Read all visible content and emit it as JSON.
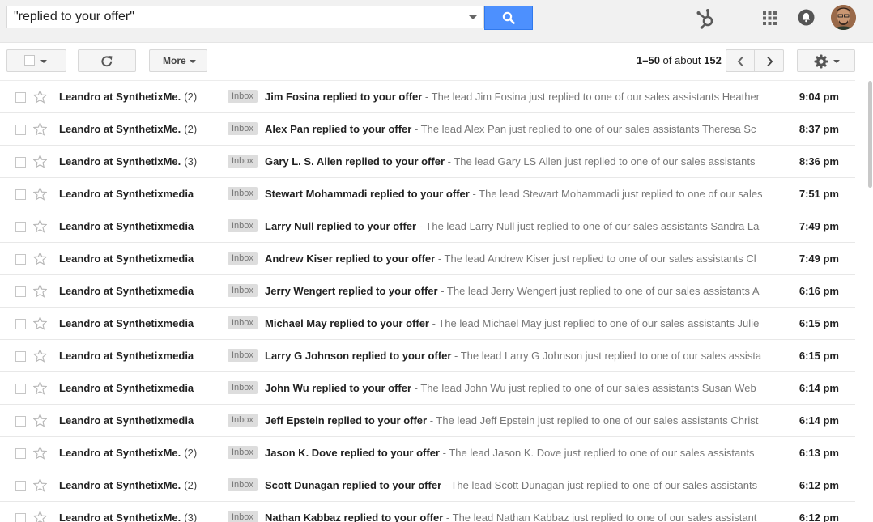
{
  "search": {
    "query": "\"replied to your offer\""
  },
  "toolbar": {
    "more_label": "More",
    "paging_range": "1–50",
    "paging_of": "of about",
    "paging_total": "152"
  },
  "icons": {
    "search": "search-icon",
    "hubspot": "hubspot-sprocket-icon",
    "apps": "apps-grid-icon",
    "notifications": "bell-icon",
    "refresh": "refresh-icon",
    "prev": "chevron-left-icon",
    "next": "chevron-right-icon",
    "settings": "gear-icon",
    "star": "star-icon"
  },
  "colors": {
    "search_button": "#4d90fe",
    "header_bg": "#f1f1f1",
    "inbox_badge_bg": "#dddddd"
  },
  "messages": [
    {
      "sender": "Leandro at ",
      "sender_org": "SynthetixMe.",
      "count": "(2)",
      "label": "Inbox",
      "subject": "Jim Fosina replied to your offer",
      "snippet": " - The lead Jim Fosina just replied to one of our sales assistants Heather",
      "time": "9:04 pm"
    },
    {
      "sender": "Leandro at ",
      "sender_org": "SynthetixMe.",
      "count": "(2)",
      "label": "Inbox",
      "subject": "Alex Pan replied to your offer",
      "snippet": " - The lead Alex Pan just replied to one of our sales assistants Theresa Sc",
      "time": "8:37 pm"
    },
    {
      "sender": "Leandro at ",
      "sender_org": "SynthetixMe.",
      "count": "(3)",
      "label": "Inbox",
      "subject": "Gary L. S. Allen replied to your offer",
      "snippet": " - The lead Gary LS Allen just replied to one of our sales assistants",
      "time": "8:36 pm"
    },
    {
      "sender": "Leandro at ",
      "sender_org": "Synthetixmedia",
      "count": "",
      "label": "Inbox",
      "subject": "Stewart Mohammadi replied to your offer",
      "snippet": " - The lead Stewart Mohammadi just replied to one of our sales",
      "time": "7:51 pm"
    },
    {
      "sender": "Leandro at ",
      "sender_org": "Synthetixmedia",
      "count": "",
      "label": "Inbox",
      "subject": "Larry Null replied to your offer",
      "snippet": " - The lead Larry Null just replied to one of our sales assistants Sandra La",
      "time": "7:49 pm"
    },
    {
      "sender": "Leandro at ",
      "sender_org": "Synthetixmedia",
      "count": "",
      "label": "Inbox",
      "subject": "Andrew Kiser replied to your offer",
      "snippet": " - The lead Andrew Kiser just replied to one of our sales assistants Cl",
      "time": "7:49 pm"
    },
    {
      "sender": "Leandro at ",
      "sender_org": "Synthetixmedia",
      "count": "",
      "label": "Inbox",
      "subject": "Jerry Wengert replied to your offer",
      "snippet": " - The lead Jerry Wengert just replied to one of our sales assistants A",
      "time": "6:16 pm"
    },
    {
      "sender": "Leandro at ",
      "sender_org": "Synthetixmedia",
      "count": "",
      "label": "Inbox",
      "subject": "Michael May replied to your offer",
      "snippet": " - The lead Michael May just replied to one of our sales assistants Julie",
      "time": "6:15 pm"
    },
    {
      "sender": "Leandro at ",
      "sender_org": "Synthetixmedia",
      "count": "",
      "label": "Inbox",
      "subject": "Larry G Johnson replied to your offer",
      "snippet": " - The lead Larry G Johnson just replied to one of our sales assista",
      "time": "6:15 pm"
    },
    {
      "sender": "Leandro at ",
      "sender_org": "Synthetixmedia",
      "count": "",
      "label": "Inbox",
      "subject": "John Wu replied to your offer",
      "snippet": " - The lead John Wu just replied to one of our sales assistants Susan Web",
      "time": "6:14 pm"
    },
    {
      "sender": "Leandro at ",
      "sender_org": "Synthetixmedia",
      "count": "",
      "label": "Inbox",
      "subject": "Jeff Epstein replied to your offer",
      "snippet": " - The lead Jeff Epstein just replied to one of our sales assistants Christ",
      "time": "6:14 pm"
    },
    {
      "sender": "Leandro at ",
      "sender_org": "SynthetixMe.",
      "count": "(2)",
      "label": "Inbox",
      "subject": "Jason K. Dove replied to your offer",
      "snippet": " - The lead Jason K. Dove just replied to one of our sales assistants",
      "time": "6:13 pm"
    },
    {
      "sender": "Leandro at ",
      "sender_org": "SynthetixMe.",
      "count": "(2)",
      "label": "Inbox",
      "subject": "Scott Dunagan replied to your offer",
      "snippet": " - The lead Scott Dunagan just replied to one of our sales assistants",
      "time": "6:12 pm"
    },
    {
      "sender": "Leandro at ",
      "sender_org": "SynthetixMe.",
      "count": "(3)",
      "label": "Inbox",
      "subject": "Nathan Kabbaz replied to your offer",
      "snippet": " - The lead Nathan Kabbaz just replied to one of our sales assistant",
      "time": "6:12 pm"
    }
  ]
}
